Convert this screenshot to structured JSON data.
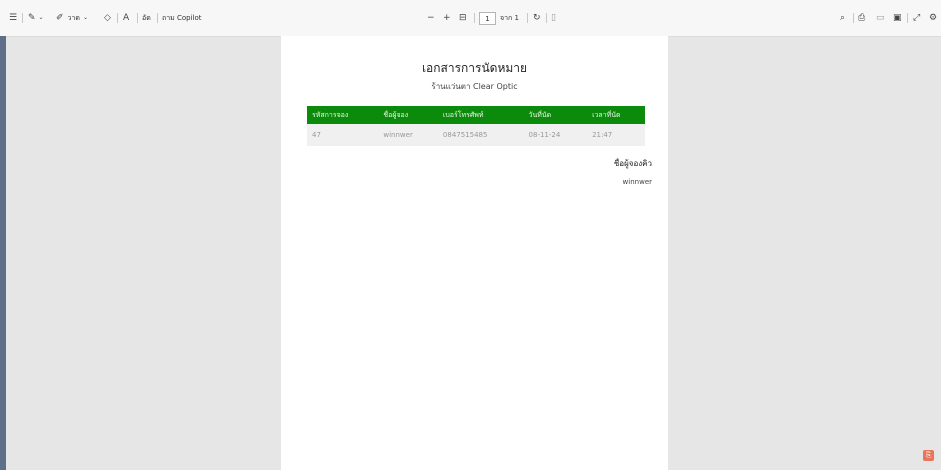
{
  "toolbar": {
    "contents_icon": "contents-list-icon",
    "draw_icon": "draw-icon",
    "highlight_icon": "highlight-icon",
    "draw_label": "วาด",
    "erase_icon": "eraser-icon",
    "read_aloud_icon": "read-aloud-icon",
    "translate_label": "อัด",
    "copilot_label": "ถาม Copilot",
    "zoom_out": "−",
    "zoom_in": "+",
    "fit_icon": "fit-page-icon",
    "page_number": "1",
    "page_total": "จาก 1",
    "rotate_icon": "rotate-icon",
    "view_icon": "page-view-icon",
    "search_icon": "search-icon",
    "print_icon": "print-icon",
    "save_icon": "save-icon",
    "saveas_icon": "save-as-icon",
    "fullscreen_icon": "fullscreen-icon",
    "settings_icon": "settings-icon"
  },
  "document": {
    "title": "เอกสารการนัดหมาย",
    "subtitle": "ร้านแว่นตา Clear Optic",
    "table": {
      "headers": [
        "รหัสการจอง",
        "ชื่อผู้จอง",
        "เบอร์โทรศัพท์",
        "วันที่นัด",
        "เวลาที่นัด"
      ],
      "rows": [
        [
          "47",
          "winnwer",
          "0847515485",
          "08-11-24",
          "21:47"
        ]
      ]
    },
    "queue_label": "ชื่อผู้จองคิว",
    "queue_name": "winnwer"
  },
  "colors": {
    "header_green": "#0b8a0b",
    "background": "#e6e6e6"
  }
}
